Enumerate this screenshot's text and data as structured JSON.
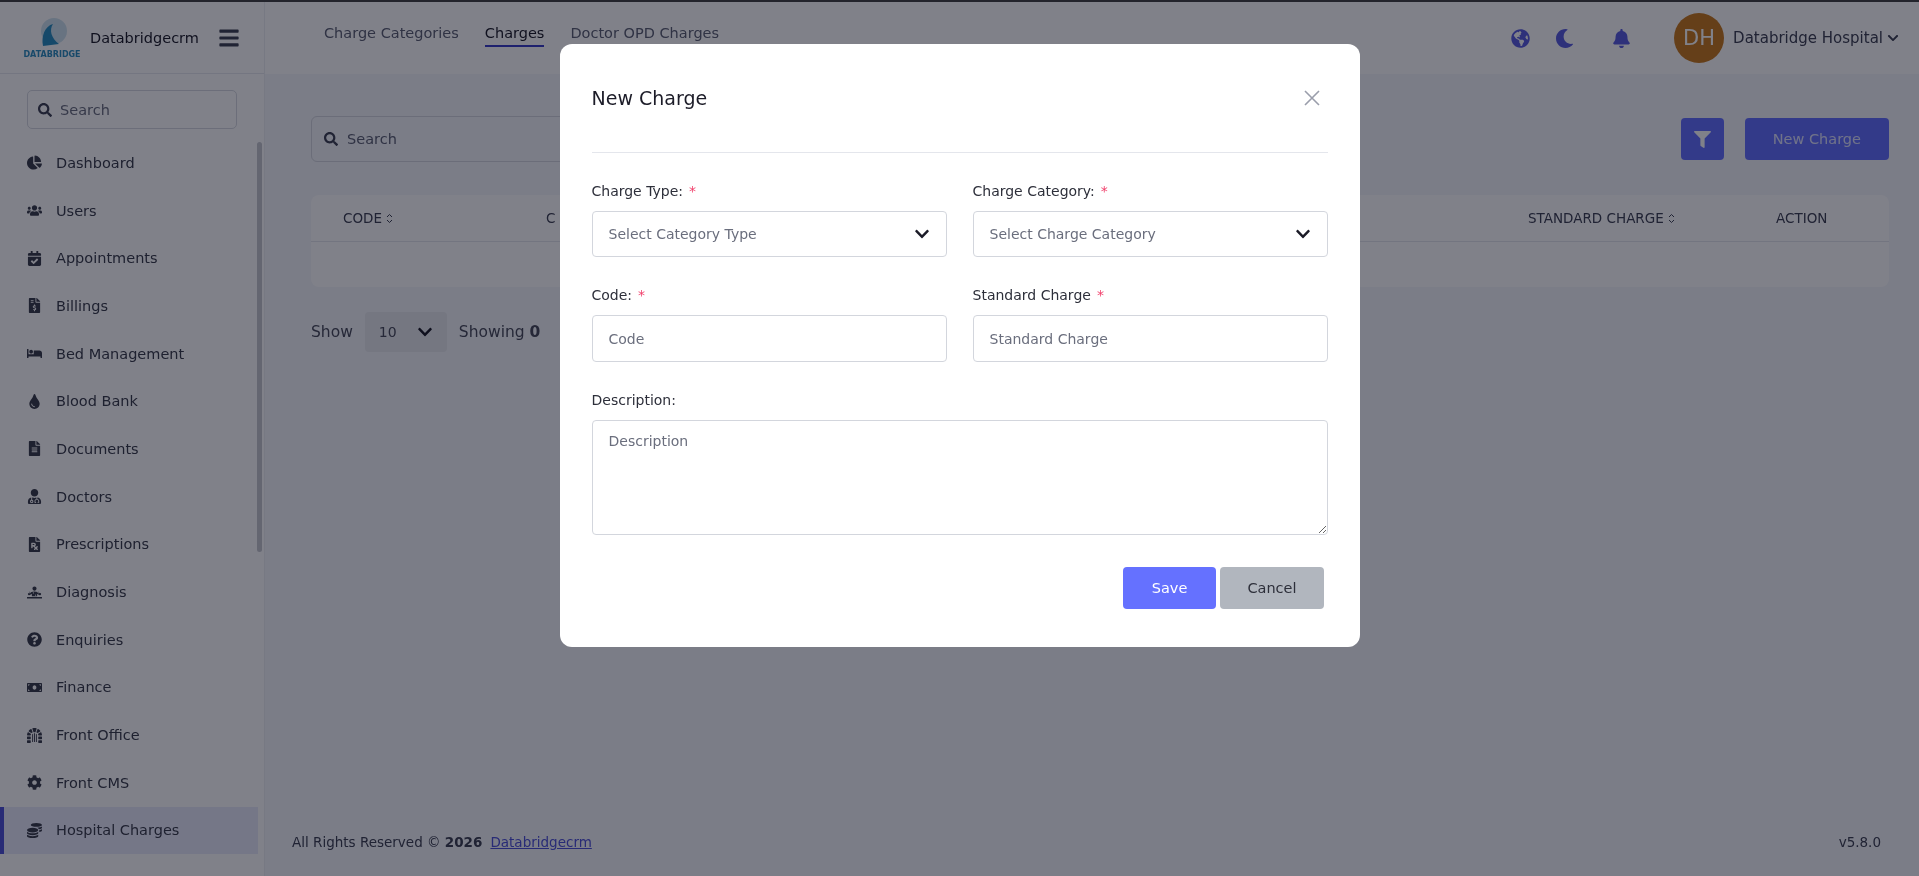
{
  "sidebar": {
    "brand": "Databridgecrm",
    "logo_text": "DATABRIDGE",
    "search": {
      "placeholder": "Search"
    },
    "items": [
      {
        "label": "Dashboard",
        "selected": false
      },
      {
        "label": "Users",
        "selected": false
      },
      {
        "label": "Appointments",
        "selected": false
      },
      {
        "label": "Billings",
        "selected": false
      },
      {
        "label": "Bed Management",
        "selected": false
      },
      {
        "label": "Blood Bank",
        "selected": false
      },
      {
        "label": "Documents",
        "selected": false
      },
      {
        "label": "Doctors",
        "selected": false
      },
      {
        "label": "Prescriptions",
        "selected": false
      },
      {
        "label": "Diagnosis",
        "selected": false
      },
      {
        "label": "Enquiries",
        "selected": false
      },
      {
        "label": "Finance",
        "selected": false
      },
      {
        "label": "Front Office",
        "selected": false
      },
      {
        "label": "Front CMS",
        "selected": false
      },
      {
        "label": "Hospital Charges",
        "selected": true
      }
    ]
  },
  "header": {
    "tabs": [
      {
        "label": "Charge Categories",
        "selected": false
      },
      {
        "label": "Charges",
        "selected": true
      },
      {
        "label": "Doctor OPD Charges",
        "selected": false
      }
    ],
    "user": {
      "initials": "DH",
      "name": "Databridge Hospital"
    }
  },
  "content": {
    "search": {
      "placeholder": "Search"
    },
    "new_button": "New Charge",
    "table": {
      "columns": [
        {
          "label": "CODE",
          "sortable": true
        },
        {
          "label": "C",
          "sortable": false
        },
        {
          "label": "STANDARD CHARGE",
          "sortable": true
        },
        {
          "label": "ACTION",
          "sortable": false
        }
      ]
    },
    "pagination": {
      "show_label": "Show",
      "page_size": "10",
      "showing": "Showing **0**"
    }
  },
  "footer": {
    "copyright": "All Rights Reserved © **2026**",
    "link": "Databridgecrm",
    "version": "v5.8.0"
  },
  "modal": {
    "title": "New Charge",
    "fields": [
      {
        "kind": "select",
        "label": "Charge Type:",
        "required_mark": "*",
        "placeholder": "Select Category Type"
      },
      {
        "kind": "select",
        "label": "Charge Category:",
        "required_mark": "*",
        "placeholder": "Select Charge Category"
      },
      {
        "kind": "input",
        "label": "Code:",
        "required_mark": "*",
        "placeholder": "Code"
      },
      {
        "kind": "input",
        "label": "Standard Charge",
        "required_mark": "*",
        "placeholder": "Standard Charge"
      },
      {
        "kind": "textarea",
        "label": "Description:",
        "placeholder": "Description"
      }
    ],
    "buttons": [
      {
        "label": "Save",
        "kind": "primary"
      },
      {
        "label": "Cancel",
        "kind": "secondary"
      }
    ]
  }
}
